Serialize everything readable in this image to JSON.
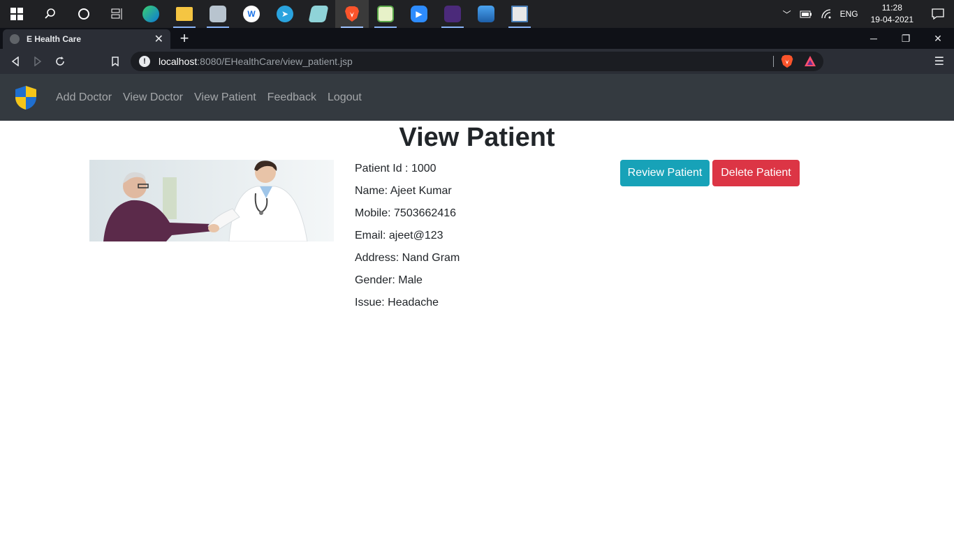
{
  "taskbar": {
    "apps": [
      {
        "name": "search-icon"
      },
      {
        "name": "cortana-icon"
      },
      {
        "name": "task-view-icon"
      },
      {
        "name": "edge-icon"
      },
      {
        "name": "file-explorer-icon"
      },
      {
        "name": "network-monitor-icon"
      },
      {
        "name": "app-w-icon"
      },
      {
        "name": "telegram-icon"
      },
      {
        "name": "notes-icon"
      },
      {
        "name": "brave-icon"
      },
      {
        "name": "spreadsheet-icon"
      },
      {
        "name": "zoom-icon"
      },
      {
        "name": "game-icon"
      },
      {
        "name": "photos-icon"
      },
      {
        "name": "window-app-icon"
      }
    ],
    "tray": {
      "language": "ENG",
      "time": "11:28",
      "date": "19-04-2021"
    }
  },
  "browser": {
    "tab_title": "E Health Care",
    "url_host": "localhost",
    "url_rest": ":8080/EHealthCare/view_patient.jsp"
  },
  "navbar": {
    "links": [
      "Add Doctor",
      "View Doctor",
      "View Patient",
      "Feedback",
      "Logout"
    ]
  },
  "page": {
    "title": "View Patient",
    "details": [
      "Patient Id : 1000",
      "Name: Ajeet Kumar",
      "Mobile: 7503662416",
      "Email: ajeet@123",
      "Address: Nand Gram",
      "Gender: Male",
      "Issue: Headache"
    ],
    "review_button": "Review Patient",
    "delete_button": "Delete Patient"
  },
  "colors": {
    "navbar_bg": "#343a40",
    "review": "#17a2b8",
    "delete": "#dc3545"
  }
}
